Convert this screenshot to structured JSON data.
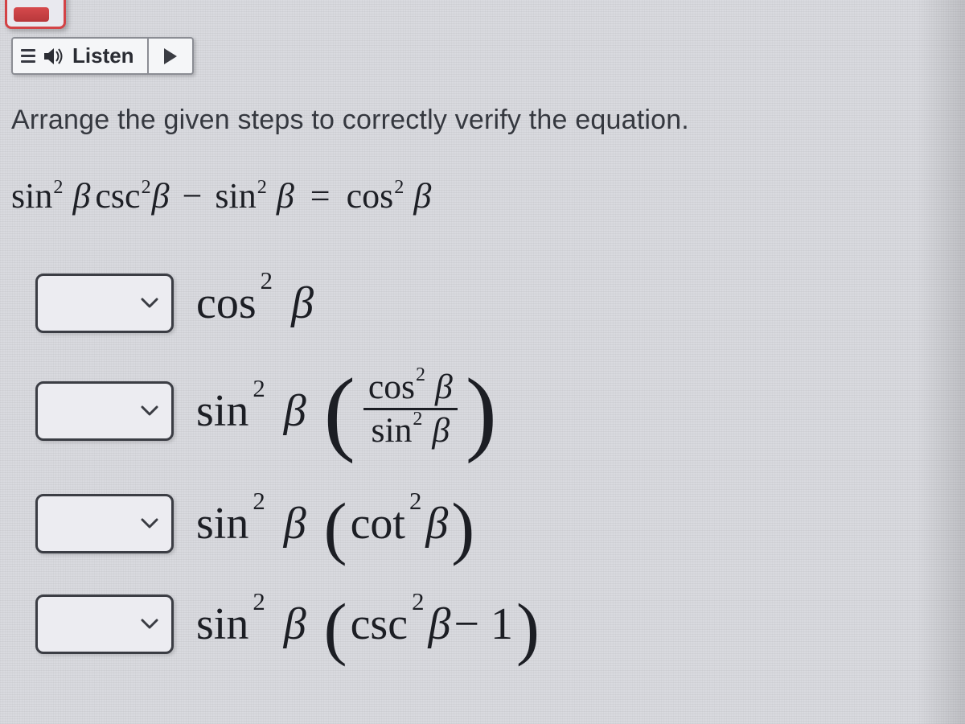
{
  "toolbar": {
    "listen_label": "Listen"
  },
  "instruction": "Arrange the given steps to correctly verify the equation.",
  "equation": {
    "lhs_a_base": "sin",
    "lhs_a_var": "β",
    "lhs_b_base": "csc",
    "lhs_b_var": "β",
    "minus": "−",
    "lhs_c_base": "sin",
    "lhs_c_var": "β",
    "equals": "=",
    "rhs_base": "cos",
    "rhs_var": "β",
    "sq": "2"
  },
  "steps": [
    {
      "id": "step1",
      "expr": {
        "a_base": "cos",
        "a_sq": "2",
        "a_var": "β"
      }
    },
    {
      "id": "step2",
      "expr": {
        "a_base": "sin",
        "a_sq": "2",
        "a_var": "β",
        "num_base": "cos",
        "num_sq": "2",
        "num_var": "β",
        "den_base": "sin",
        "den_sq": "2",
        "den_var": "β"
      }
    },
    {
      "id": "step3",
      "expr": {
        "a_base": "sin",
        "a_sq": "2",
        "a_var": "β",
        "b_base": "cot",
        "b_sq": "2",
        "b_var": "β"
      }
    },
    {
      "id": "step4",
      "expr": {
        "a_base": "sin",
        "a_sq": "2",
        "a_var": "β",
        "b_base": "csc",
        "b_sq": "2",
        "b_var": "β",
        "tail": " − 1"
      }
    }
  ]
}
